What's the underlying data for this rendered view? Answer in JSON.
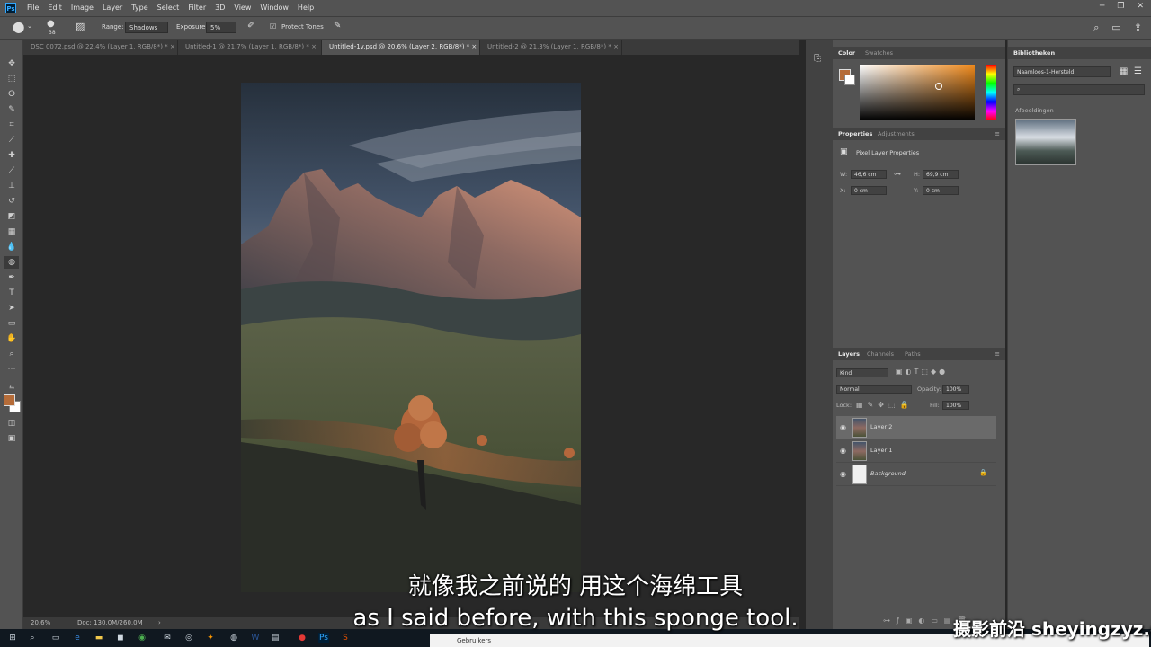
{
  "app": {
    "logo": "Ps"
  },
  "menu": [
    "File",
    "Edit",
    "Image",
    "Layer",
    "Type",
    "Select",
    "Filter",
    "3D",
    "View",
    "Window",
    "Help"
  ],
  "window_controls": {
    "minimize": "─",
    "restore": "❐",
    "close": "✕"
  },
  "options": {
    "brush_size": "38",
    "range_label": "Range:",
    "range_value": "Shadows",
    "exposure_label": "Exposure:",
    "exposure_value": "5%",
    "protect_tones": "Protect Tones"
  },
  "tabs": [
    {
      "label": "DSC 0072.psd @ 22,4% (Layer 1, RGB/8*) *"
    },
    {
      "label": "Untitled-1 @ 21,7% (Layer 1, RGB/8*) *"
    },
    {
      "label": "Untitled-1v.psd @ 20,6% (Layer 2, RGB/8*) *"
    },
    {
      "label": "Untitled-2 @ 21,3% (Layer 1, RGB/8*) *"
    }
  ],
  "tab_close": "×",
  "status": {
    "zoom": "20,6%",
    "doc": "Doc: 130,0M/260,0M",
    "arrow": "›"
  },
  "color_panel": {
    "tab1": "Color",
    "tab2": "Swatches",
    "fg": "#b56c39"
  },
  "properties": {
    "tab1": "Properties",
    "tab2": "Adjustments",
    "title": "Pixel Layer Properties",
    "w_label": "W:",
    "w": "46,6 cm",
    "h_label": "H:",
    "h": "69,9 cm",
    "x_label": "X:",
    "x": "0 cm",
    "y_label": "Y:",
    "y": "0 cm"
  },
  "layers_panel": {
    "tab1": "Layers",
    "tab2": "Channels",
    "tab3": "Paths",
    "kind": "Kind",
    "blend": "Normal",
    "opacity_label": "Opacity:",
    "opacity": "100%",
    "lock_label": "Lock:",
    "fill_label": "Fill:",
    "fill": "100%",
    "layers": [
      {
        "name": "Layer 2"
      },
      {
        "name": "Layer 1"
      },
      {
        "name": "Background"
      }
    ]
  },
  "libraries": {
    "title": "Bibliotheken",
    "library": "Naamloos-1-Hersteld",
    "section": "Afbeeldingen"
  },
  "explorer": {
    "label": "Gebruikers"
  },
  "subtitle_cn": "就像我之前说的 用这个海绵工具",
  "subtitle_en": "as I said before, with this sponge tool.",
  "watermark": "摄影前沿 sheyingzyz.com",
  "accent": {
    "canvas_sky": "#2e3a45",
    "ui_gray": "#535353"
  }
}
